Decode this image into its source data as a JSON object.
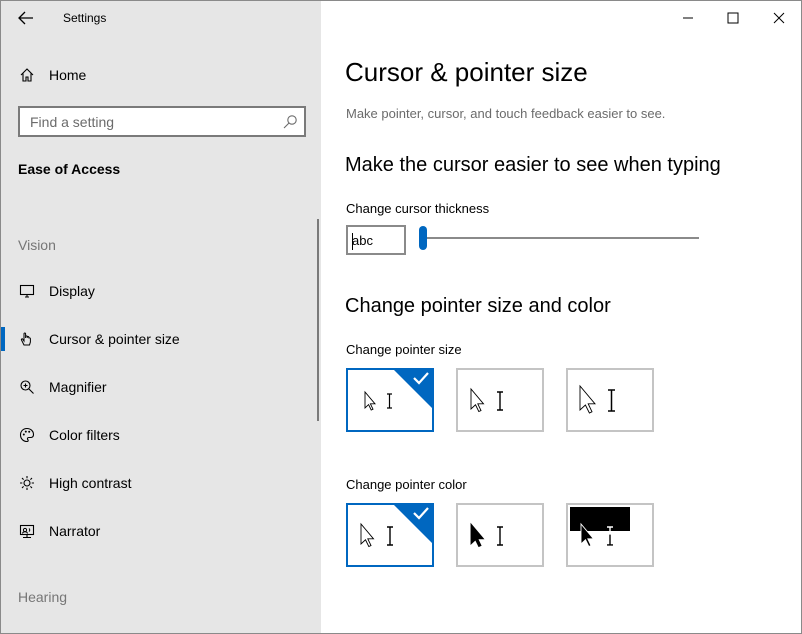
{
  "window": {
    "title": "Settings",
    "controls": {
      "minimize_icon": "minimize-icon",
      "maximize_icon": "maximize-icon",
      "close_icon": "close-icon"
    }
  },
  "sidebar": {
    "home_label": "Home",
    "search_placeholder": "Find a setting",
    "section_title": "Ease of Access",
    "group_vision": "Vision",
    "items": [
      {
        "label": "Display",
        "icon": "monitor-icon"
      },
      {
        "label": "Cursor & pointer size",
        "icon": "pointer-hand-icon",
        "selected": true
      },
      {
        "label": "Magnifier",
        "icon": "magnifier-icon"
      },
      {
        "label": "Color filters",
        "icon": "palette-icon"
      },
      {
        "label": "High contrast",
        "icon": "sun-icon"
      },
      {
        "label": "Narrator",
        "icon": "narrator-icon"
      }
    ],
    "group_hearing": "Hearing"
  },
  "main": {
    "title": "Cursor & pointer size",
    "subtitle": "Make pointer, cursor, and touch feedback easier to see.",
    "section_cursor": {
      "heading": "Make the cursor easier to see when typing",
      "thickness_label": "Change cursor thickness",
      "preview_text": "abc",
      "thickness_value": 1,
      "thickness_min": 1,
      "thickness_max": 20
    },
    "section_pointer": {
      "heading": "Change pointer size and color",
      "size_label": "Change pointer size",
      "size_options": [
        "small",
        "medium",
        "large"
      ],
      "size_selected": 0,
      "color_label": "Change pointer color",
      "color_options": [
        "white",
        "black",
        "inverted"
      ],
      "color_selected": 0
    }
  },
  "colors": {
    "accent": "#0067c0",
    "sidebar_bg": "#e6e6e6"
  }
}
